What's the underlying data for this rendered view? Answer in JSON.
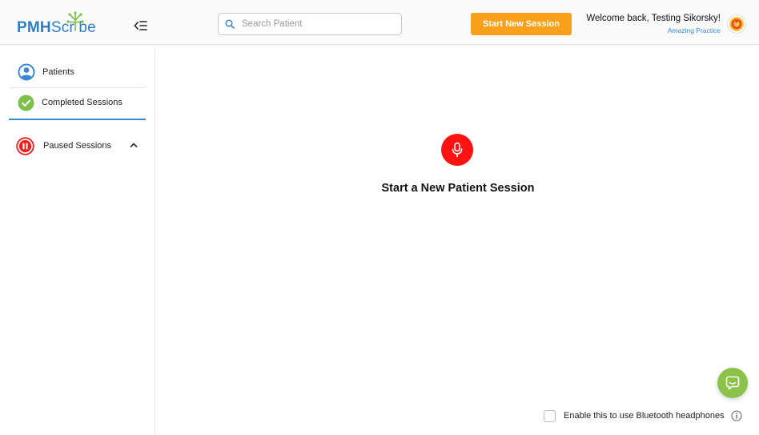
{
  "brand": {
    "logo_text_pmh": "PMH",
    "logo_text_scribe": "Scr be",
    "accent": "#2f7fc8",
    "tree_color": "#7cc04b"
  },
  "header": {
    "search_placeholder": "Search Patient",
    "start_button_label": "Start New Session",
    "start_button_color": "#f9a11b",
    "welcome_text": "Welcome back, Testing Sikorsky!",
    "practice_name": "Amazing Practice"
  },
  "sidebar": {
    "items": [
      {
        "label": "Patients",
        "icon": "user-circle-icon"
      },
      {
        "label": "Completed Sessions",
        "icon": "check-circle-icon"
      },
      {
        "label": "Paused Sessions",
        "icon": "pause-circle-icon"
      }
    ]
  },
  "main": {
    "title": "Start a New Patient Session",
    "mic_color": "#ff1212"
  },
  "footer": {
    "bluetooth_label": "Enable this to use Bluetooth headphones",
    "bluetooth_enabled": false
  },
  "chat": {
    "color": "#8bc34a",
    "icon": "chat-bubble-icon"
  }
}
